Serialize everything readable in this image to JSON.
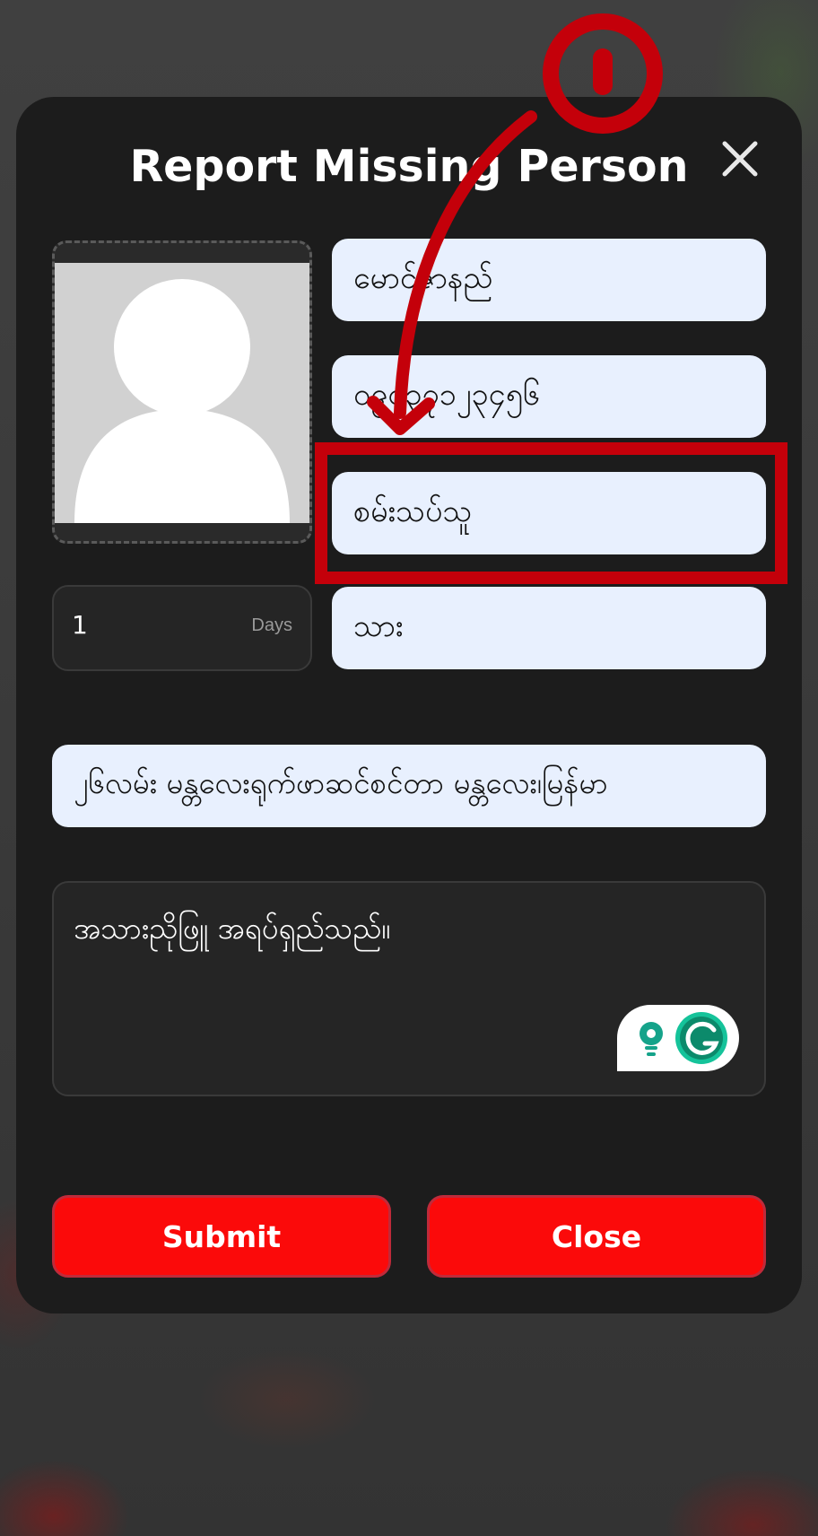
{
  "modal": {
    "title": "Report Missing Person",
    "close_icon": "close-icon"
  },
  "photo": {
    "icon": "avatar-placeholder-icon"
  },
  "fields": {
    "name": "မောင်ဇာနည်",
    "phone": "၀၉၄၃၇၁၂၃၄၅၆",
    "status": "စမ်းသပ်သူ",
    "relation": "သား",
    "address": "၂၆လမ်း မန္တလေးရုက်ဖာဆင်စင်တာ မန္တလေး၊မြန်မာ"
  },
  "days": {
    "value": "1",
    "unit": "Days"
  },
  "description": {
    "value": "အသားညိုဖြူ အရပ်ရှည်သည်။"
  },
  "buttons": {
    "submit": "Submit",
    "close": "Close"
  },
  "annotation": {
    "step_number": "1",
    "color": "#c4000a"
  },
  "grammarly": {
    "icons": [
      "lightbulb-icon",
      "grammarly-g-icon"
    ]
  }
}
